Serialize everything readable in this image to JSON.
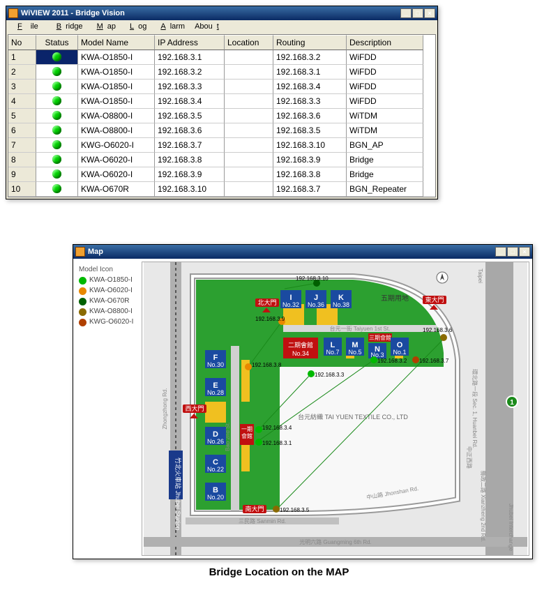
{
  "caption": "Bridge Location on the MAP",
  "main_window": {
    "title": "WiVIEW 2011 - Bridge Vision",
    "menu": [
      "File",
      "Bridge",
      "Map",
      "Log",
      "Alarm",
      "About"
    ],
    "columns": [
      "No",
      "Status",
      "Model Name",
      "IP Address",
      "Location",
      "Routing",
      "Description"
    ],
    "rows": [
      {
        "no": "1",
        "status": "up",
        "model": "KWA-O1850-I",
        "ip": "192.168.3.1",
        "loc": "",
        "routing": "192.168.3.2",
        "desc": "WiFDD",
        "selected": true
      },
      {
        "no": "2",
        "status": "up",
        "model": "KWA-O1850-I",
        "ip": "192.168.3.2",
        "loc": "",
        "routing": "192.168.3.1",
        "desc": "WiFDD"
      },
      {
        "no": "3",
        "status": "up",
        "model": "KWA-O1850-I",
        "ip": "192.168.3.3",
        "loc": "",
        "routing": "192.168.3.4",
        "desc": "WiFDD"
      },
      {
        "no": "4",
        "status": "up",
        "model": "KWA-O1850-I",
        "ip": "192.168.3.4",
        "loc": "",
        "routing": "192.168.3.3",
        "desc": "WiFDD"
      },
      {
        "no": "5",
        "status": "up",
        "model": "KWA-O8800-I",
        "ip": "192.168.3.5",
        "loc": "",
        "routing": "192.168.3.6",
        "desc": "WiTDM"
      },
      {
        "no": "6",
        "status": "up",
        "model": "KWA-O8800-I",
        "ip": "192.168.3.6",
        "loc": "",
        "routing": "192.168.3.5",
        "desc": "WiTDM"
      },
      {
        "no": "7",
        "status": "up",
        "model": "KWG-O6020-I",
        "ip": "192.168.3.7",
        "loc": "",
        "routing": "192.168.3.10",
        "desc": "BGN_AP"
      },
      {
        "no": "8",
        "status": "up",
        "model": "KWA-O6020-I",
        "ip": "192.168.3.8",
        "loc": "",
        "routing": "192.168.3.9",
        "desc": "Bridge"
      },
      {
        "no": "9",
        "status": "up",
        "model": "KWA-O6020-I",
        "ip": "192.168.3.9",
        "loc": "",
        "routing": "192.168.3.8",
        "desc": "Bridge"
      },
      {
        "no": "10",
        "status": "up",
        "model": "KWA-O670R",
        "ip": "192.168.3.10",
        "loc": "",
        "routing": "192.168.3.7",
        "desc": "BGN_Repeater"
      }
    ]
  },
  "map_window": {
    "title": "Map",
    "legend_title": "Model Icon",
    "legend": [
      {
        "color": "#00b900",
        "label": "KWA-O1850-I"
      },
      {
        "color": "#e88800",
        "label": "KWA-O6020-I"
      },
      {
        "color": "#006000",
        "label": "KWA-O670R"
      },
      {
        "color": "#8a6a00",
        "label": "KWA-O8800-I"
      },
      {
        "color": "#b04000",
        "label": "KWG-O6020-I"
      }
    ],
    "roads": {
      "zhongzhong": "Zhongzhong Rd.",
      "taiyuen": "台元一街 Taiyuen 1st St.",
      "bao": "Bao 2nd St.",
      "jhonshan": "中山路 Jhonshan Rd.",
      "guangming": "光明六路 Guangming 6th Rd.",
      "sanmin": "三民路 Sanmin Rd.",
      "huanbei": "環北路一段 Sec. 1, Huanbei Rd.",
      "xianzheng": "縣政二路 Xianzheng 2nd Rd.",
      "zhongzheng": "中正西路",
      "taipei": "Taipei"
    },
    "gates": {
      "north": "北大門",
      "west": "西大門",
      "south": "南大門",
      "east": "東大門"
    },
    "company": "台元紡織 TAI YUEN TEXTILE CO., LTD",
    "area5": "五期用地",
    "station": "竹北火車站 Jhubei Station",
    "interchange": "Jhubei Interchange",
    "buildings": [
      {
        "id": "B",
        "no": "No.20"
      },
      {
        "id": "C",
        "no": "No.22"
      },
      {
        "id": "D",
        "no": "No.26"
      },
      {
        "id": "E",
        "no": "No.28"
      },
      {
        "id": "F",
        "no": "No.30"
      },
      {
        "id": "I",
        "no": "No.32"
      },
      {
        "id": "J",
        "no": "No.36"
      },
      {
        "id": "K",
        "no": "No.38"
      },
      {
        "id": "L",
        "no": "No.7"
      },
      {
        "id": "M",
        "no": "No.5"
      },
      {
        "id": "N",
        "no": "No.3"
      },
      {
        "id": "O",
        "no": "No.1"
      }
    ],
    "hall2": {
      "label": "二期會館",
      "no": "No.34"
    },
    "hall1": {
      "label": "一期會館"
    },
    "hall3": {
      "label": "三期會館"
    },
    "nodes": [
      {
        "ip": "192.168.3.1",
        "color": "#00b900"
      },
      {
        "ip": "192.168.3.2",
        "color": "#00b900"
      },
      {
        "ip": "192.168.3.3",
        "color": "#00b900"
      },
      {
        "ip": "192.168.3.4",
        "color": "#00b900"
      },
      {
        "ip": "192.168.3.5",
        "color": "#8a6a00"
      },
      {
        "ip": "192.168.3.6",
        "color": "#8a6a00"
      },
      {
        "ip": "192.168.3.7",
        "color": "#b04000"
      },
      {
        "ip": "192.168.3.8",
        "color": "#e88800"
      },
      {
        "ip": "192.168.3.9",
        "color": "#e88800"
      },
      {
        "ip": "192.168.3.10",
        "color": "#006000"
      }
    ]
  }
}
